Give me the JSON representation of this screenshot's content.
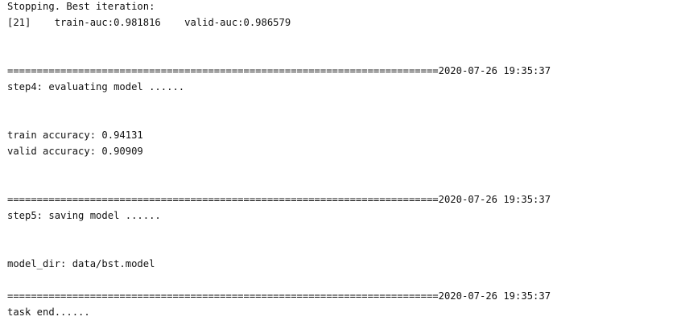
{
  "console": {
    "stopping": "Stopping. Best iteration:",
    "best_iteration": "[21]    train-auc:0.981816    valid-auc:0.986579",
    "separator1": "=========================================================================2020-07-26 19:35:37",
    "step4": "step4: evaluating model ......",
    "train_accuracy": "train accuracy: 0.94131",
    "valid_accuracy": "valid accuracy: 0.90909",
    "separator2": "=========================================================================2020-07-26 19:35:37",
    "step5": "step5: saving model ......",
    "model_dir": "model_dir: data/bst.model",
    "separator3": "=========================================================================2020-07-26 19:35:37",
    "task_end": "task end......"
  }
}
